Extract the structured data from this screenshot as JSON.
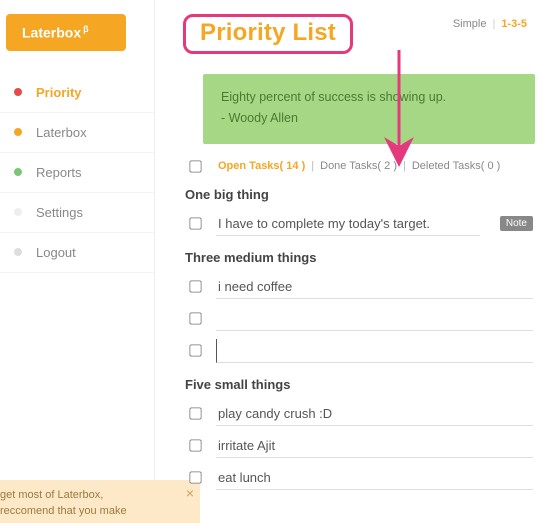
{
  "logo": {
    "name": "Laterbox",
    "badge": "β"
  },
  "nav": {
    "items": [
      {
        "label": "Priority"
      },
      {
        "label": "Laterbox"
      },
      {
        "label": "Reports"
      },
      {
        "label": "Settings"
      },
      {
        "label": "Logout"
      }
    ]
  },
  "tip": {
    "line1": "get most of Laterbox,",
    "line2": "reccomend that you make"
  },
  "header": {
    "title": "Priority List",
    "view_label": "Simple",
    "mode_value": "1-3-5"
  },
  "quote": {
    "line1": "Eighty percent of success is showing up.",
    "line2": "- Woody Allen"
  },
  "filters": {
    "open": {
      "label": "Open Tasks",
      "count": 14
    },
    "done": {
      "label": "Done Tasks",
      "count": 2
    },
    "deleted": {
      "label": "Deleted Tasks",
      "count": 0
    }
  },
  "sections": {
    "big": {
      "heading": "One big thing",
      "tasks": [
        "I have to complete my today's target."
      ],
      "note_label": "Note"
    },
    "medium": {
      "heading": "Three medium things",
      "tasks": [
        "i need coffee",
        "",
        ""
      ]
    },
    "small": {
      "heading": "Five small things",
      "tasks": [
        "play candy crush :D",
        "irritate Ajit",
        "eat lunch"
      ]
    }
  }
}
